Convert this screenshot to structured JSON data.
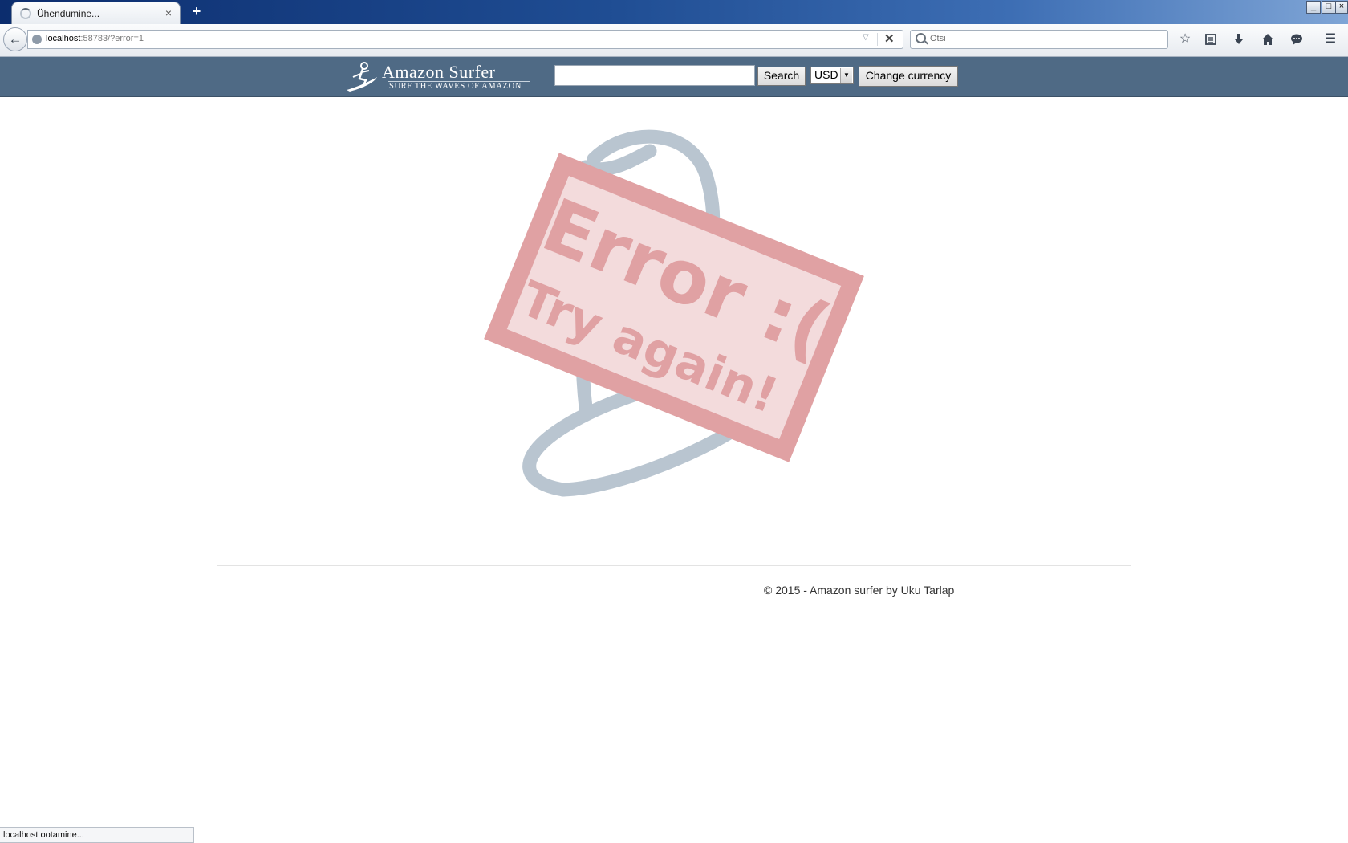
{
  "browser": {
    "tab": {
      "title": "Ühendumine...",
      "close_glyph": "×"
    },
    "new_tab_glyph": "+",
    "window_controls": {
      "minimize": "_",
      "maximize": "□",
      "close": "×"
    },
    "url": {
      "host": "localhost",
      "rest": ":58783/?error=1"
    },
    "search_placeholder": "Otsi",
    "nav_icons": [
      "back-arrow-icon",
      "bookmark-star-icon",
      "reading-list-icon",
      "download-icon",
      "home-icon",
      "chat-icon",
      "menu-icon"
    ],
    "status_text": "localhost ootamine..."
  },
  "site": {
    "logo": {
      "title": "Amazon Surfer",
      "tagline": "SURF THE WAVES OF AMAZON"
    },
    "search": {
      "value": "",
      "button_label": "Search"
    },
    "currency": {
      "selected": "USD",
      "button_label": "Change currency"
    },
    "error_image": {
      "line1": "Error :(",
      "line2": "Try again!"
    },
    "footer": "© 2015 - Amazon surfer by Uku Tarlap"
  },
  "colors": {
    "site_header": "#4f6a85",
    "stamp": "#e0a1a3",
    "surfboard": "#b9c5d0"
  }
}
